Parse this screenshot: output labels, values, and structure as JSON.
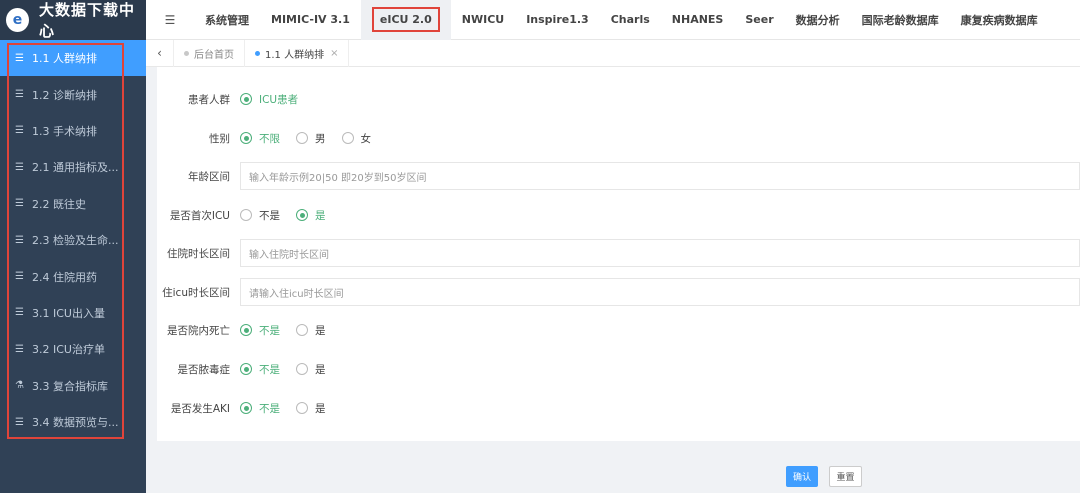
{
  "app": {
    "title": "大数据下载中心",
    "logo_letter": "e"
  },
  "sidebar": {
    "items": [
      {
        "label": "1.1 人群纳排",
        "icon": "list-icon",
        "glyph": "☰",
        "active": true
      },
      {
        "label": "1.2 诊断纳排",
        "icon": "list-icon",
        "glyph": "☰"
      },
      {
        "label": "1.3 手术纳排",
        "icon": "list-icon",
        "glyph": "☰"
      },
      {
        "label": "2.1 通用指标及...",
        "icon": "list-icon",
        "glyph": "☰"
      },
      {
        "label": "2.2 既往史",
        "icon": "list-icon",
        "glyph": "☰"
      },
      {
        "label": "2.3 检验及生命...",
        "icon": "list-icon",
        "glyph": "☰"
      },
      {
        "label": "2.4 住院用药",
        "icon": "list-icon",
        "glyph": "☰"
      },
      {
        "label": "3.1 ICU出入量",
        "icon": "list-icon",
        "glyph": "☰"
      },
      {
        "label": "3.2 ICU治疗单",
        "icon": "list-icon",
        "glyph": "☰"
      },
      {
        "label": "3.3 复合指标库",
        "icon": "flask-icon",
        "glyph": "⚗"
      },
      {
        "label": "3.4 数据预览与...",
        "icon": "list-icon",
        "glyph": "☰"
      }
    ]
  },
  "topnav": {
    "hamburger_glyph": "☰",
    "items": [
      "系统管理",
      "MIMIC-IV 3.1",
      "eICU 2.0",
      "NWICU",
      "Inspire1.3",
      "Charls",
      "NHANES",
      "Seer",
      "数据分析",
      "国际老龄数据库",
      "康复疾病数据库"
    ],
    "active_index": 2
  },
  "tags": {
    "back_glyph": "‹",
    "items": [
      {
        "label": "后台首页"
      },
      {
        "label": "1.1 人群纳排",
        "close": "×"
      }
    ]
  },
  "form": {
    "population": {
      "label": "患者人群",
      "options": [
        "ICU患者"
      ],
      "selected": 0
    },
    "gender": {
      "label": "性别",
      "options": [
        "不限",
        "男",
        "女"
      ],
      "selected": 0
    },
    "age": {
      "label": "年龄区间",
      "placeholder": "输入年龄示例20|50 即20岁到50岁区间"
    },
    "first_icu": {
      "label": "是否首次ICU",
      "options": [
        "不是",
        "是"
      ],
      "selected": 1
    },
    "hosp_los": {
      "label": "住院时长区间",
      "placeholder": "输入住院时长区间"
    },
    "icu_los": {
      "label": "住icu时长区间",
      "placeholder": "请输入住icu时长区间"
    },
    "hosp_death": {
      "label": "是否院内死亡",
      "options": [
        "不是",
        "是"
      ],
      "selected": 0
    },
    "sepsis": {
      "label": "是否脓毒症",
      "options": [
        "不是",
        "是"
      ],
      "selected": 0
    },
    "aki": {
      "label": "是否发生AKI",
      "options": [
        "不是",
        "是"
      ],
      "selected": 0
    }
  },
  "buttons": {
    "confirm": "确认",
    "reset": "重置"
  }
}
